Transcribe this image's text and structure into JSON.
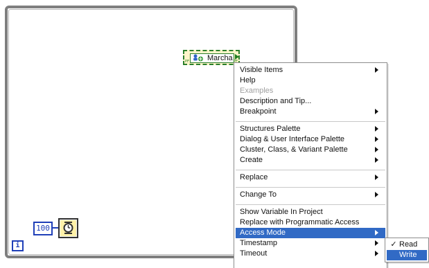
{
  "diagram": {
    "constant_value": "100",
    "iteration_label": "i",
    "property_node_label": "Marcha",
    "property_node_left_tiny": "PF",
    "property_node_right_tiny": "PF"
  },
  "context_menu": {
    "items": [
      {
        "label": "Visible Items"
      },
      {
        "label": "Help"
      },
      {
        "label": "Examples"
      },
      {
        "label": "Description and Tip..."
      },
      {
        "label": "Breakpoint"
      },
      {
        "label": "Structures Palette"
      },
      {
        "label": "Dialog & User Interface Palette"
      },
      {
        "label": "Cluster, Class, & Variant Palette"
      },
      {
        "label": "Create"
      },
      {
        "label": "Replace"
      },
      {
        "label": "Change To"
      },
      {
        "label": "Show Variable In Project"
      },
      {
        "label": "Replace with Programmatic Access"
      },
      {
        "label": "Access Mode"
      },
      {
        "label": "Timestamp"
      },
      {
        "label": "Timeout"
      }
    ]
  },
  "submenu": {
    "items": [
      {
        "label": "Read",
        "checked": true
      },
      {
        "label": "Write"
      }
    ]
  },
  "colors": {
    "highlight": "#316ac5",
    "loop_border": "#7f7f7f",
    "node_blue": "#1f3fb8",
    "node_green": "#2a7f2a",
    "wait_fill": "#fff1a8"
  },
  "icons": {
    "wait_timer": "wait-timer-icon",
    "variable": "shared-variable-icon",
    "submenu": "chevron-right-icon",
    "check": "checkmark-icon"
  }
}
